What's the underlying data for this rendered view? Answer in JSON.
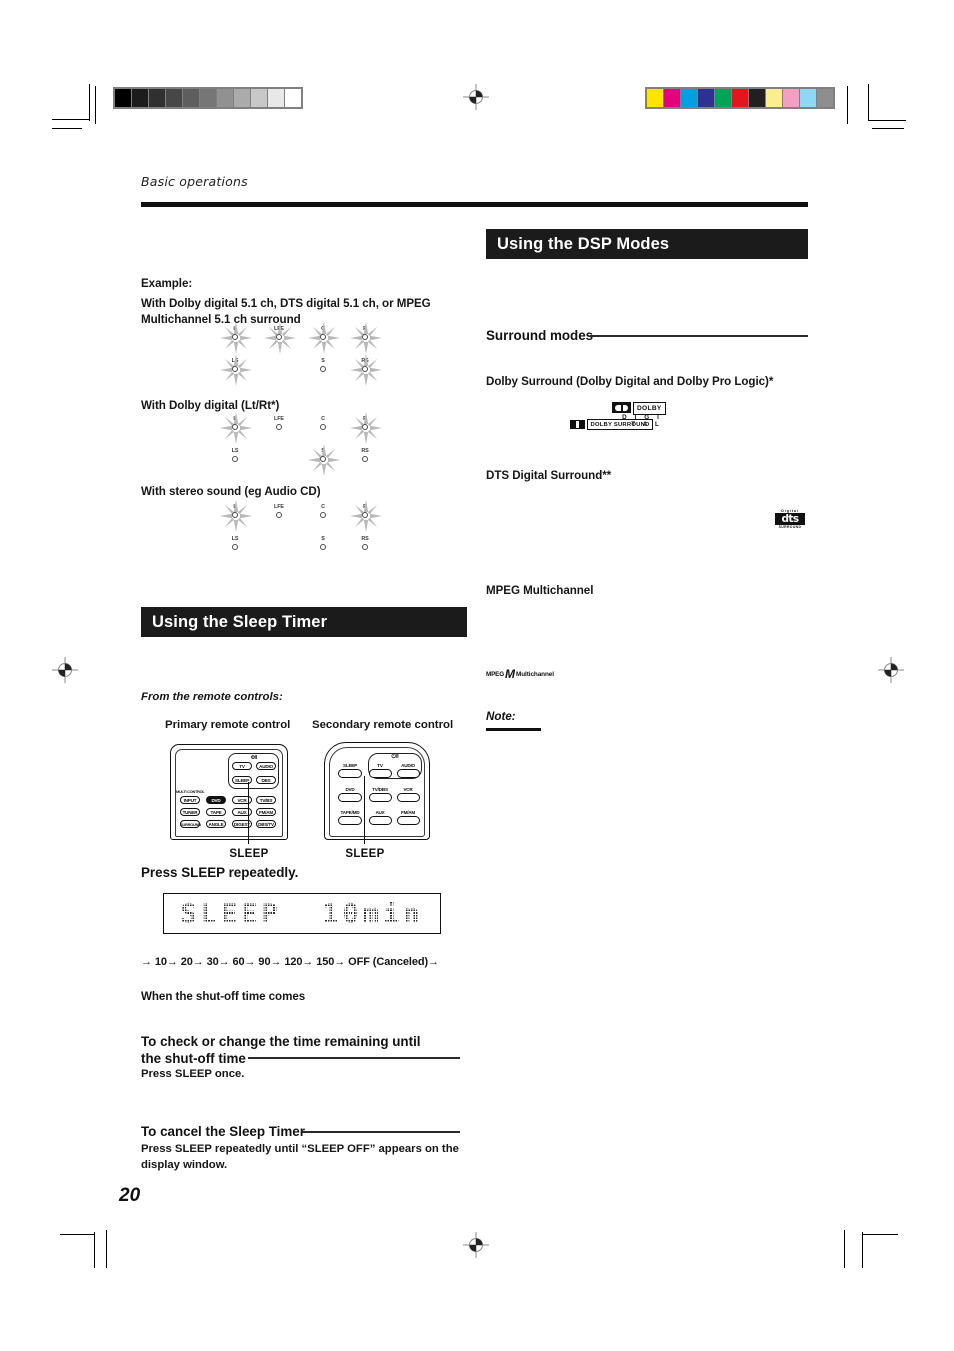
{
  "document": {
    "running_head": "Basic operations",
    "page_number": "20"
  },
  "calibration": {
    "gray_steps": [
      "#000000",
      "#1c1c1c",
      "#303030",
      "#474747",
      "#5e5e5e",
      "#767676",
      "#919191",
      "#ababab",
      "#c8c8c8",
      "#e8e8e8",
      "#ffffff"
    ],
    "color_swatches": [
      "#ffe400",
      "#e5007e",
      "#00a0e2",
      "#2e3192",
      "#00a459",
      "#e2161c",
      "#231f20",
      "#fbee91",
      "#f59ec4",
      "#8ed8f3",
      "#8e8e8e"
    ]
  },
  "left_column": {
    "example_label": "Example:",
    "diagrams": [
      {
        "caption": "With Dolby digital 5.1 ch, DTS digital 5.1 ch, or MPEG Multichannel 5.1 ch surround",
        "row1": [
          {
            "label": "L",
            "lit": true
          },
          {
            "label": "LFE",
            "lit": true
          },
          {
            "label": "C",
            "lit": true
          },
          {
            "label": "R",
            "lit": true
          }
        ],
        "row2": [
          {
            "label": "LS",
            "lit": true
          },
          {
            "label": "S",
            "lit": false
          },
          {
            "label": "RS",
            "lit": true
          }
        ]
      },
      {
        "caption": "With Dolby digital (Lt/Rt*)",
        "row1": [
          {
            "label": "L",
            "lit": true
          },
          {
            "label": "LFE",
            "lit": false
          },
          {
            "label": "C",
            "lit": false
          },
          {
            "label": "R",
            "lit": true
          }
        ],
        "row2": [
          {
            "label": "LS",
            "lit": false
          },
          {
            "label": "S",
            "lit": true
          },
          {
            "label": "RS",
            "lit": false
          }
        ]
      },
      {
        "caption": "With stereo sound (eg Audio CD)",
        "row1": [
          {
            "label": "L",
            "lit": true
          },
          {
            "label": "LFE",
            "lit": false
          },
          {
            "label": "C",
            "lit": false
          },
          {
            "label": "R",
            "lit": true
          }
        ],
        "row2": [
          {
            "label": "LS",
            "lit": false
          },
          {
            "label": "S",
            "lit": false
          },
          {
            "label": "RS",
            "lit": false
          }
        ]
      }
    ],
    "sleep_timer": {
      "banner_title": "Using the Sleep Timer",
      "intro": "From the remote controls:",
      "primary_remote_caption": "Primary remote control",
      "secondary_remote_caption": "Secondary remote control",
      "primary_callout": "SLEEP",
      "secondary_callout": "SLEEP",
      "instruction": "Press SLEEP repeatedly.",
      "display_text": "SLEEP  10min",
      "sequence": "→ 10→ 20→ 30→ 60→ 90→ 120→ 150→ OFF (Canceled)→",
      "shutoff_heading": "When the shut-off time comes",
      "check_heading_line1": "To check or change the time remaining until",
      "check_heading_line2": "the shut-off time",
      "check_body": "Press SLEEP once.",
      "cancel_heading": "To cancel the Sleep Timer",
      "cancel_body": "Press SLEEP repeatedly until “SLEEP OFF” appears on the display window."
    },
    "primary_remote": {
      "power_symbol": "Φ/I",
      "group_label": "MULTI CONTROL",
      "buttons": [
        [
          "TV",
          "AUDIO"
        ],
        [
          "SLEEP",
          "DBS"
        ],
        [
          "INPUT",
          "DVD",
          "VCR",
          "TV/BS"
        ],
        [
          "TUNER",
          "TAPE",
          "AUX",
          "FM/AM"
        ],
        [
          "SURROUND",
          "ANGLE",
          "DIGEST",
          "DBS/TV"
        ]
      ]
    },
    "secondary_remote": {
      "power_symbol": "⏻/I",
      "buttons": [
        [
          "SLEEP",
          "TV",
          "AUDIO"
        ],
        [
          "DVD",
          "TV/DBS",
          "VCR"
        ],
        [
          "TAPE/MD",
          "AUX",
          "FM/AM"
        ]
      ]
    }
  },
  "right_column": {
    "banner_title": "Using the DSP Modes",
    "surround_modes_heading": "Surround modes",
    "modes": [
      {
        "name": "Dolby Surround (Dolby Digital and Dolby Pro Logic)*",
        "logos": [
          "dolby-digital",
          "dolby-surround"
        ]
      },
      {
        "name": "DTS Digital Surround**",
        "logos": [
          "dts-digital-surround"
        ]
      },
      {
        "name": "MPEG Multichannel",
        "logos": [
          "mpeg-multichannel"
        ]
      }
    ],
    "logo_text": {
      "dolby_word": "DOLBY",
      "dolby_digital": "D I G I T A L",
      "dolby_surround_word": "DOLBY SURROUND",
      "dts_top": "Digital",
      "dts_main": "dts",
      "dts_bottom": "SURROUND",
      "mpeg_prefix": "MPEG",
      "mpeg_glyph": "M",
      "mpeg_suffix": "Multichannel"
    },
    "note_label": "Note:"
  }
}
